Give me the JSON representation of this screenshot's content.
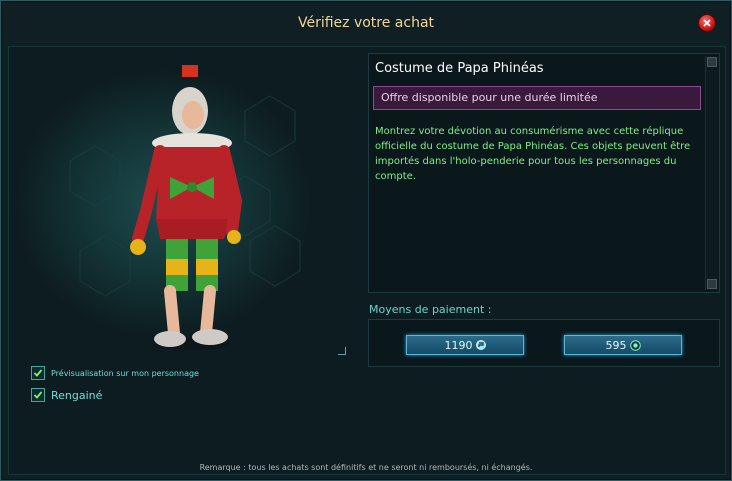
{
  "window": {
    "title": "Vérifiez votre achat"
  },
  "preview": {
    "checkbox_preview_label": "Prévisualisation sur mon personnage",
    "checkbox_preview_checked": true,
    "checkbox_sheathed_label": "Rengainé",
    "checkbox_sheathed_checked": true
  },
  "item": {
    "name": "Costume de Papa Phinéas",
    "offer": "Offre disponible pour une durée limitée",
    "description": "Montrez votre dévotion au consumérisme avec cette réplique officielle du costume de Papa Phinéas. Ces objets peuvent être importés dans l'holo-penderie pour tous les personnages du compte."
  },
  "payment": {
    "label": "Moyens de paiement :",
    "options": [
      {
        "amount": "1190",
        "icon": "protobucks-icon"
      },
      {
        "amount": "595",
        "icon": "omnibit-icon"
      }
    ]
  },
  "footer": {
    "note": "Remarque : tous les achats sont définitifs et ne seront ni remboursés, ni échangés."
  },
  "colors": {
    "title": "#f3d79a",
    "offer_bg": "#3a1a3c",
    "description": "#7ff08a",
    "accent": "#5fb6d8"
  }
}
